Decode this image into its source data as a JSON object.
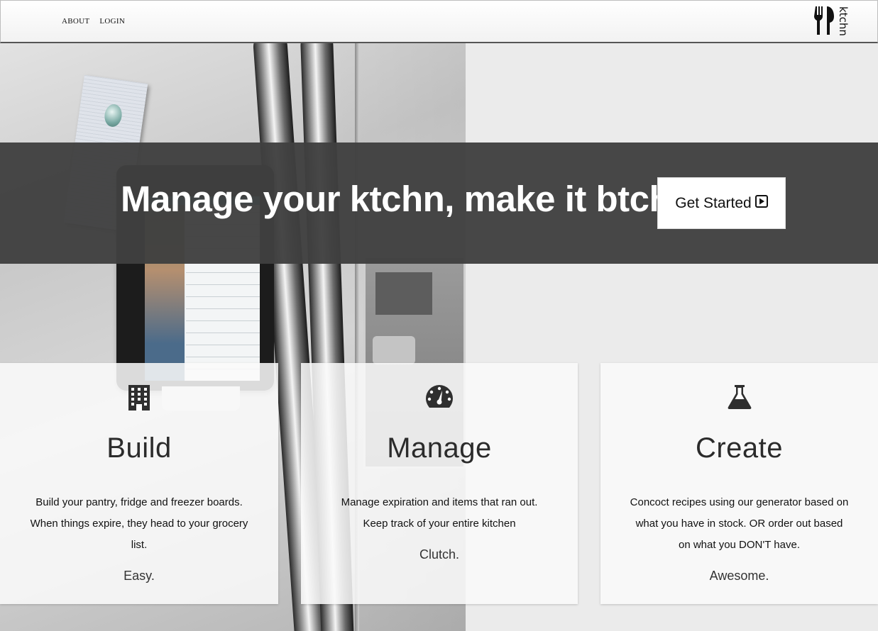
{
  "nav": {
    "links": [
      "ABOUT",
      "LOGIN"
    ],
    "brand": "ktchn"
  },
  "hero": {
    "headline": "Manage your ktchn, make it btchn.",
    "cta_label": "Get Started"
  },
  "features": [
    {
      "icon": "building-icon",
      "title": "Build",
      "description": "Build your pantry, fridge and freezer boards. When things expire, they head to your grocery list.",
      "tagline": "Easy."
    },
    {
      "icon": "dashboard-icon",
      "title": "Manage",
      "description": "Manage expiration and items that ran out. Keep track of your entire kitchen",
      "tagline": "Clutch."
    },
    {
      "icon": "flask-icon",
      "title": "Create",
      "description": "Concoct recipes using our generator based on what you have in stock. OR order out based on what you DON'T have.",
      "tagline": "Awesome."
    }
  ],
  "colors": {
    "banner": "#404040",
    "card": "#fafafa",
    "text": "#222222"
  }
}
